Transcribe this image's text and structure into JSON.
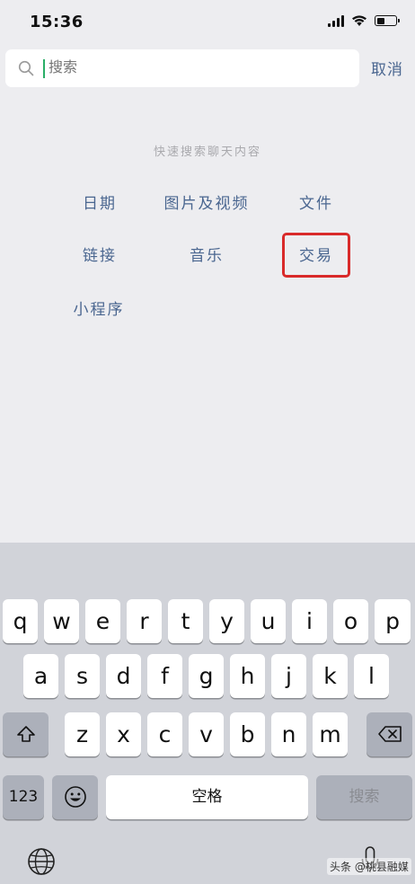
{
  "status_bar": {
    "time": "15:36"
  },
  "search": {
    "placeholder": "搜索",
    "cancel_label": "取消"
  },
  "quick_search": {
    "title": "快速搜索聊天内容",
    "items": [
      "日期",
      "图片及视频",
      "文件",
      "链接",
      "音乐",
      "交易",
      "小程序"
    ],
    "highlighted_item": "交易",
    "highlight_color": "#d92a2a",
    "link_color": "#4a6690"
  },
  "keyboard": {
    "row1": [
      "q",
      "w",
      "e",
      "r",
      "t",
      "y",
      "u",
      "i",
      "o",
      "p"
    ],
    "row2": [
      "a",
      "s",
      "d",
      "f",
      "g",
      "h",
      "j",
      "k",
      "l"
    ],
    "row3": [
      "z",
      "x",
      "c",
      "v",
      "b",
      "n",
      "m"
    ],
    "numbers_key": "123",
    "space_key": "空格",
    "search_key": "搜索"
  },
  "watermark": "头条 @桃县融媒"
}
